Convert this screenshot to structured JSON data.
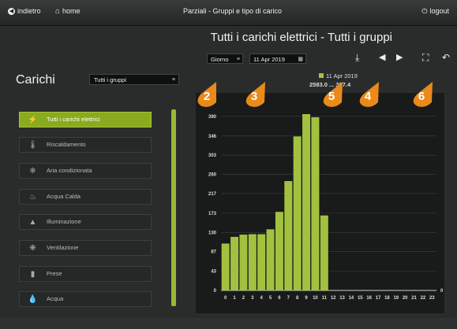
{
  "topbar": {
    "back_label": "indietro",
    "home_label": "home",
    "title": "Parziali - Gruppi e tipo di carico",
    "logout_label": "logout"
  },
  "main_title": "Tutti i carichi elettrici - Tutti i gruppi",
  "controls": {
    "period_value": "Giorno",
    "date_value": "11 Apr 2019"
  },
  "sidebar": {
    "title": "Carichi",
    "group_select_value": "Tutti i gruppi",
    "items": [
      {
        "label": "Tutti i carichi elettrici",
        "icon": "lightning-icon",
        "active": true
      },
      {
        "label": "Riscaldamento",
        "icon": "thermometer-icon",
        "active": false
      },
      {
        "label": "Aria condizionata",
        "icon": "snowflake-icon",
        "active": false
      },
      {
        "label": "Acqua Calda",
        "icon": "faucet-icon",
        "active": false
      },
      {
        "label": "Illuminazione",
        "icon": "lamp-icon",
        "active": false
      },
      {
        "label": "Ventilazione",
        "icon": "fan-icon",
        "active": false
      },
      {
        "label": "Prese",
        "icon": "plug-icon",
        "active": false
      },
      {
        "label": "Acqua",
        "icon": "water-drop-icon",
        "active": false
      }
    ]
  },
  "annotations": [
    "2",
    "3",
    "5",
    "4",
    "6"
  ],
  "legend": {
    "text": "11 Apr 2019",
    "color": "#a2c23f"
  },
  "totals_text": "2583.0 ... 387.4",
  "chart_data": {
    "type": "bar",
    "categories": [
      "0",
      "1",
      "2",
      "3",
      "4",
      "5",
      "6",
      "7",
      "8",
      "9",
      "10",
      "11",
      "12",
      "13",
      "14",
      "15",
      "16",
      "17",
      "18",
      "19",
      "20",
      "21",
      "22",
      "23"
    ],
    "series": [
      {
        "values": [
          105,
          120,
          125,
          126,
          126,
          137,
          176,
          245,
          345,
          395,
          388,
          168,
          0,
          0,
          0,
          0,
          0,
          0,
          0,
          0,
          0,
          0,
          0,
          0
        ]
      }
    ],
    "yticks": [
      "0",
      "43",
      "87",
      "130",
      "173",
      "217",
      "260",
      "303",
      "346",
      "390"
    ],
    "ylim": [
      0,
      432
    ],
    "y2ticks": [
      "0"
    ],
    "grid": true,
    "bar_color": "#a2c23f"
  }
}
